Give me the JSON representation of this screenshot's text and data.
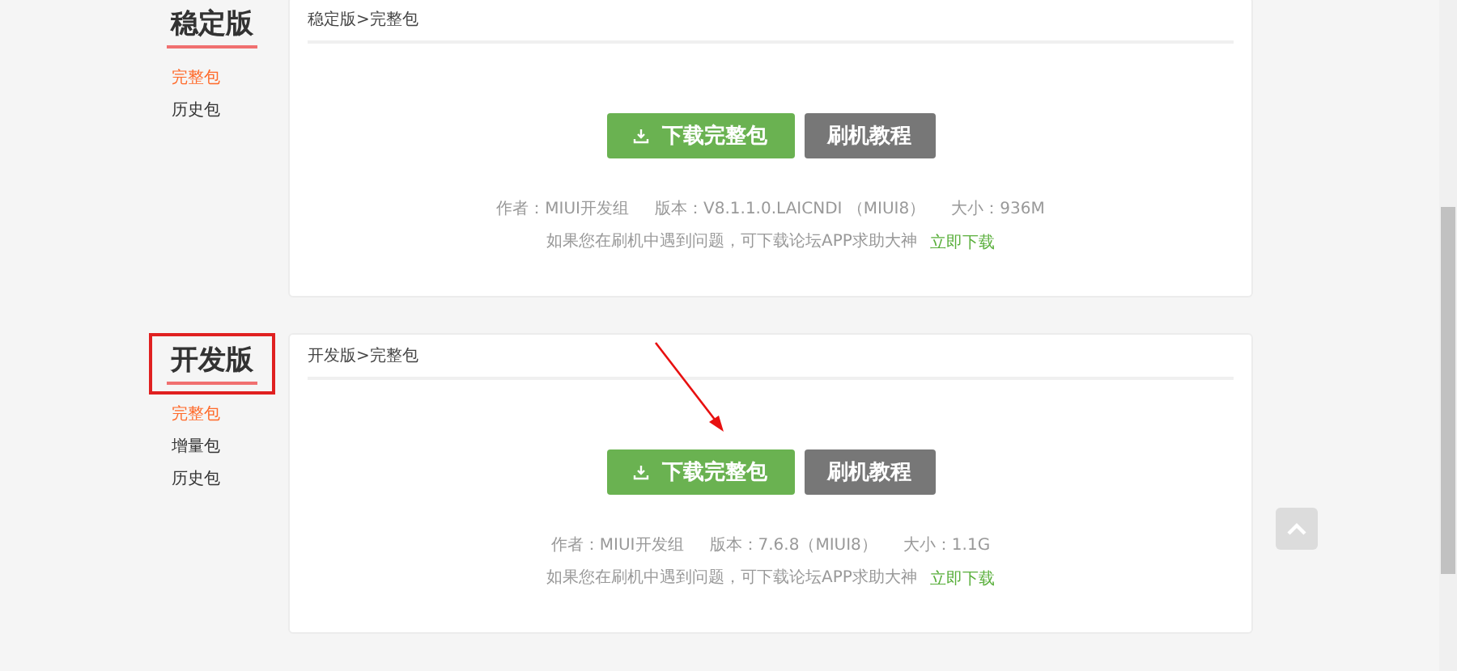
{
  "sections": [
    {
      "title": "稳定版",
      "highlighted": false,
      "menu": [
        {
          "label": "完整包",
          "selected": true
        },
        {
          "label": "历史包",
          "selected": false
        }
      ],
      "breadcrumb": "稳定版>完整包",
      "buttons": [
        {
          "label": "下载完整包",
          "kind": "download"
        },
        {
          "label": "刷机教程",
          "kind": "tutorial"
        }
      ],
      "info": [
        "作者：MIUI开发组",
        "版本：V8.1.1.0.LAICNDI （MIUI8）",
        "大小：936M"
      ],
      "help": "如果您在刷机中遇到问题，可下载论坛APP求助大神",
      "link": "立即下载"
    },
    {
      "title": "开发版",
      "highlighted": true,
      "menu": [
        {
          "label": "完整包",
          "selected": true
        },
        {
          "label": "增量包",
          "selected": false
        },
        {
          "label": "历史包",
          "selected": false
        }
      ],
      "breadcrumb": "开发版>完整包",
      "buttons": [
        {
          "label": "下载完整包",
          "kind": "download"
        },
        {
          "label": "刷机教程",
          "kind": "tutorial"
        }
      ],
      "info": [
        "作者：MIUI开发组",
        "版本：7.6.8（MIUI8）",
        "大小：1.1G"
      ],
      "help": "如果您在刷机中遇到问题，可下载论坛APP求助大神",
      "link": "立即下载"
    }
  ]
}
